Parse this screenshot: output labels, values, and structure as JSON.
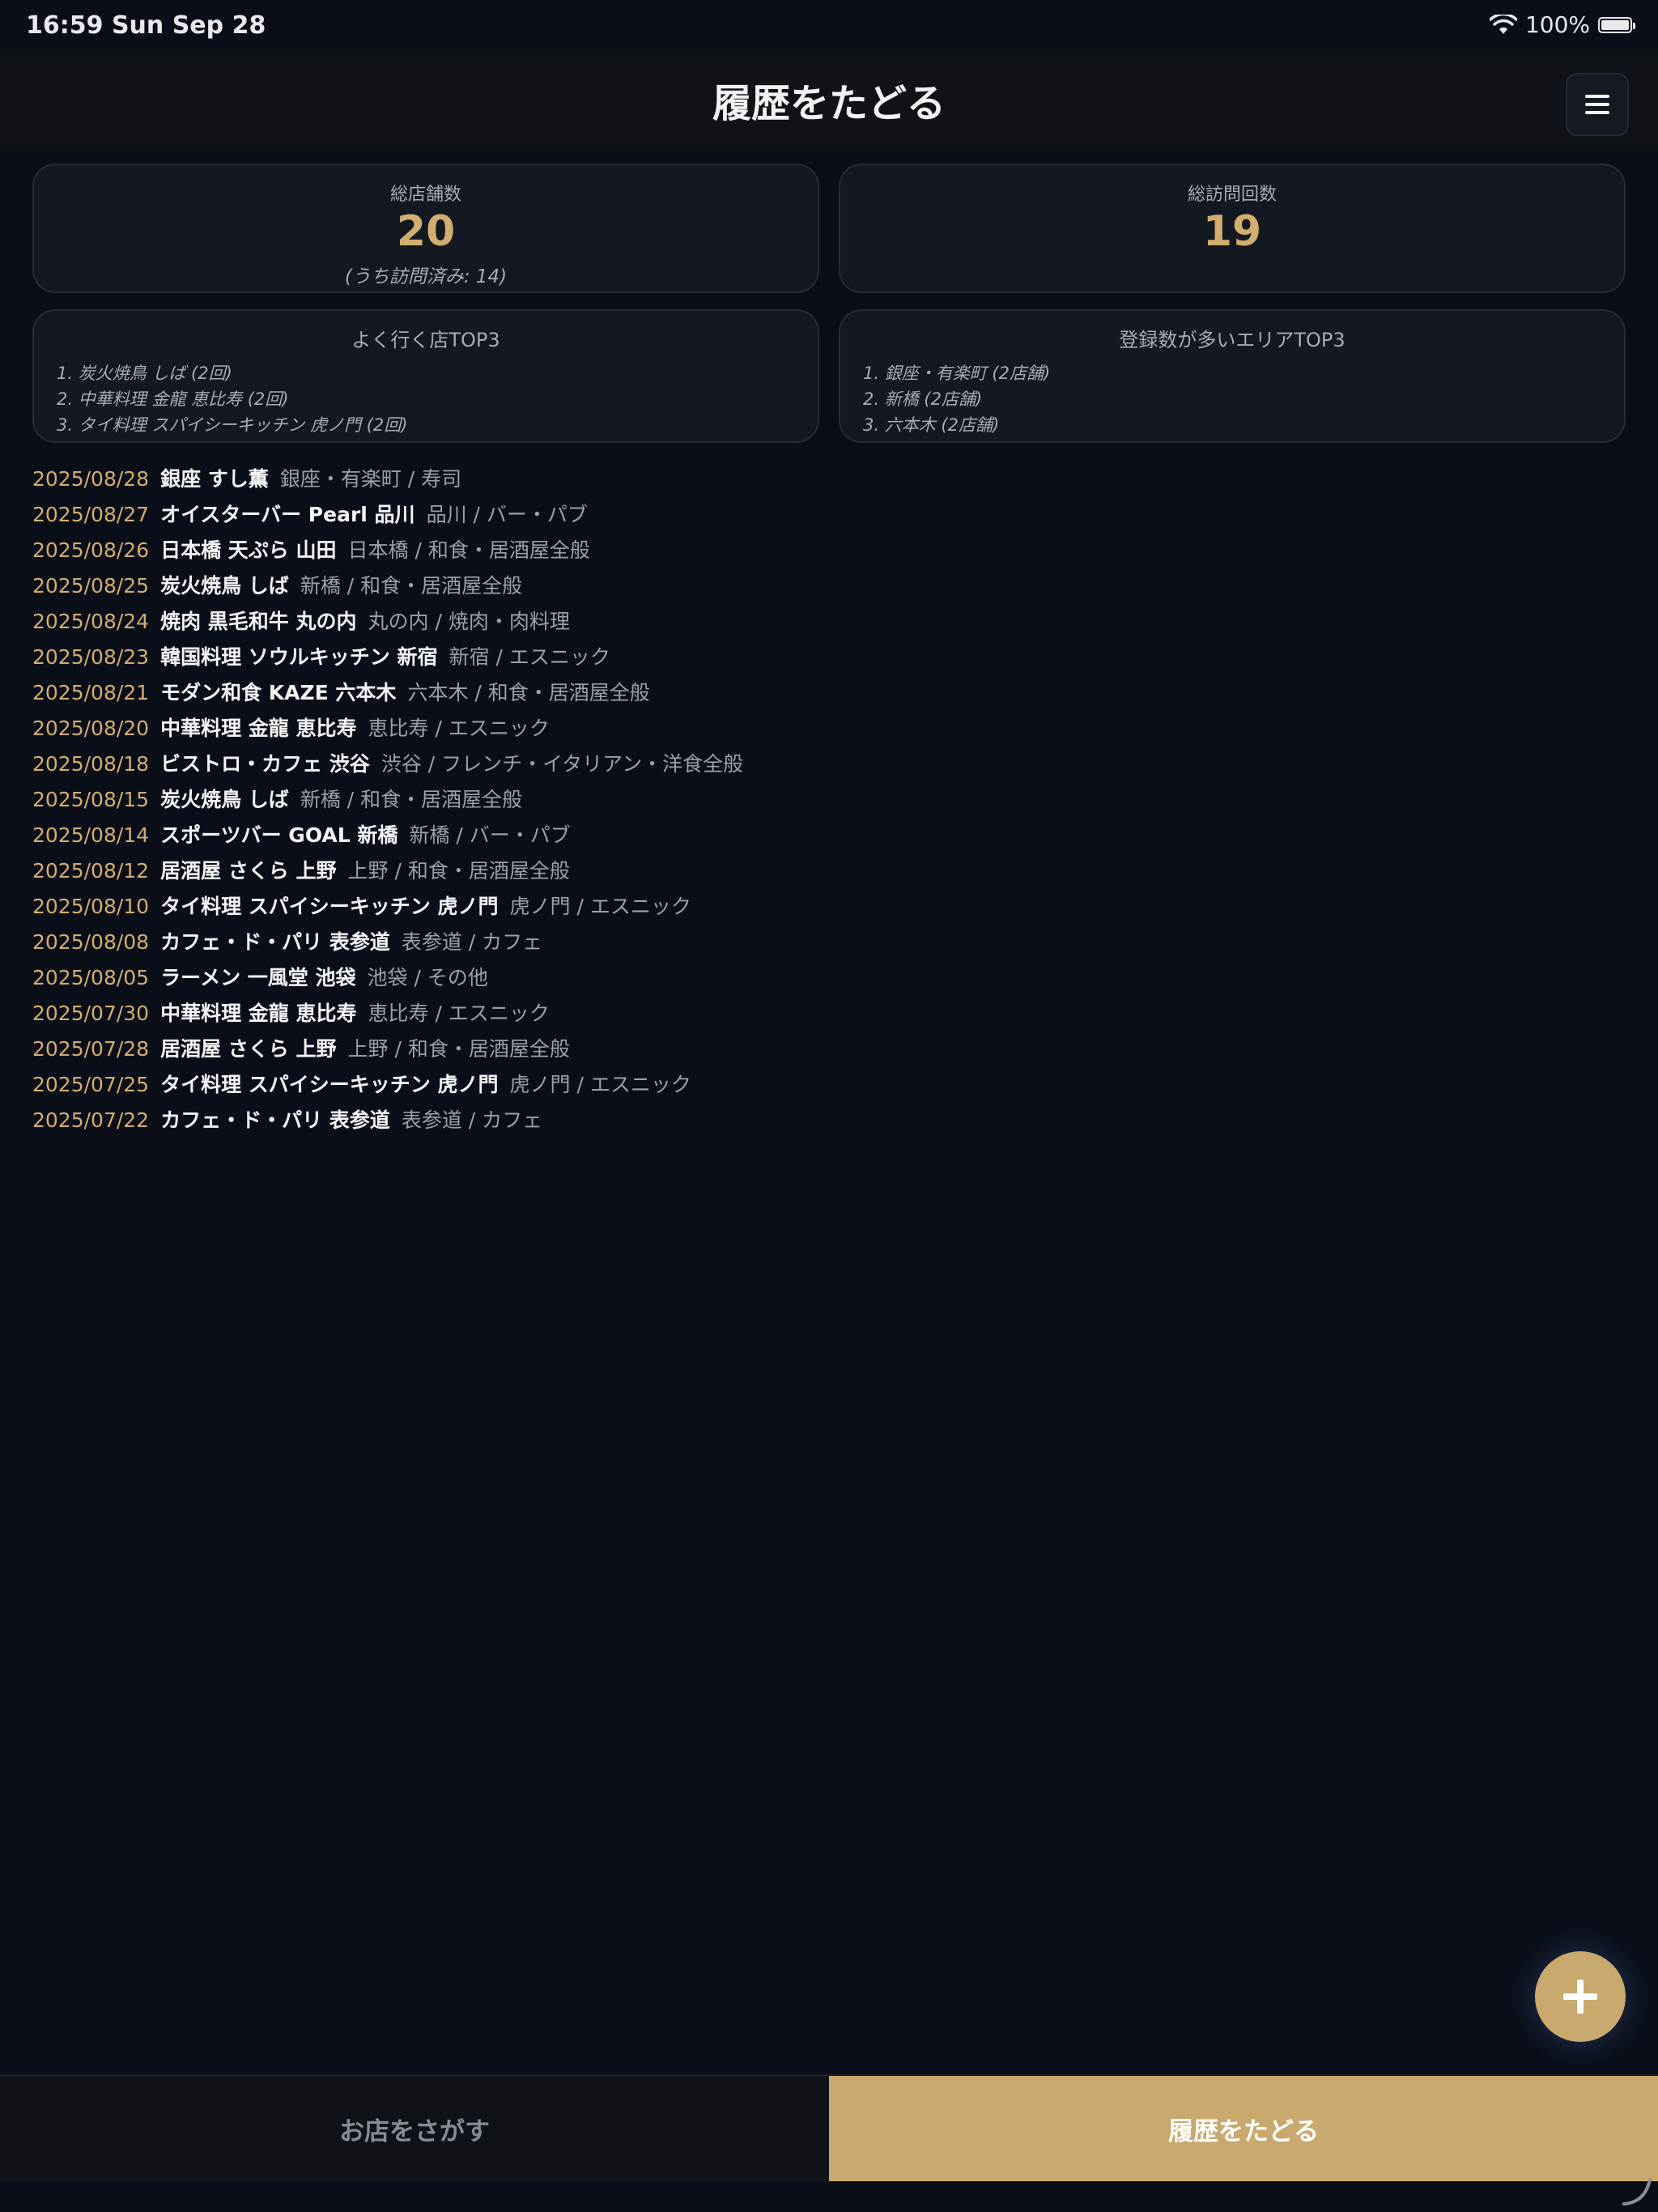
{
  "status": {
    "time": "16:59  Sun Sep 28",
    "battery": "100%"
  },
  "header": {
    "title": "履歴をたどる"
  },
  "stats": {
    "total_stores": {
      "label": "総店舗数",
      "value": "20",
      "sub": "(うち訪問済み: 14)"
    },
    "total_visits": {
      "label": "総訪問回数",
      "value": "19"
    }
  },
  "top_stores": {
    "label": "よく行く店TOP3",
    "items": [
      "1. 炭火焼鳥 しば (2回)",
      "2. 中華料理 金龍 恵比寿 (2回)",
      "3. タイ料理 スパイシーキッチン 虎ノ門 (2回)"
    ]
  },
  "top_areas": {
    "label": "登録数が多いエリアTOP3",
    "items": [
      "1. 銀座・有楽町 (2店舗)",
      "2. 新橋 (2店舗)",
      "3. 六本木 (2店舗)"
    ]
  },
  "history": [
    {
      "date": "2025/08/28",
      "name": "銀座 すし薫",
      "meta": "銀座・有楽町 / 寿司"
    },
    {
      "date": "2025/08/27",
      "name": "オイスターバー Pearl 品川",
      "meta": "品川 / バー・パブ"
    },
    {
      "date": "2025/08/26",
      "name": "日本橋 天ぷら 山田",
      "meta": "日本橋 / 和食・居酒屋全般"
    },
    {
      "date": "2025/08/25",
      "name": "炭火焼鳥 しば",
      "meta": "新橋 / 和食・居酒屋全般"
    },
    {
      "date": "2025/08/24",
      "name": "焼肉 黒毛和牛 丸の内",
      "meta": "丸の内 / 焼肉・肉料理"
    },
    {
      "date": "2025/08/23",
      "name": "韓国料理 ソウルキッチン 新宿",
      "meta": "新宿 / エスニック"
    },
    {
      "date": "2025/08/21",
      "name": "モダン和食 KAZE 六本木",
      "meta": "六本木 / 和食・居酒屋全般"
    },
    {
      "date": "2025/08/20",
      "name": "中華料理 金龍 恵比寿",
      "meta": "恵比寿 / エスニック"
    },
    {
      "date": "2025/08/18",
      "name": "ビストロ・カフェ 渋谷",
      "meta": "渋谷 / フレンチ・イタリアン・洋食全般"
    },
    {
      "date": "2025/08/15",
      "name": "炭火焼鳥 しば",
      "meta": "新橋 / 和食・居酒屋全般"
    },
    {
      "date": "2025/08/14",
      "name": "スポーツバー GOAL 新橋",
      "meta": "新橋 / バー・パブ"
    },
    {
      "date": "2025/08/12",
      "name": "居酒屋 さくら 上野",
      "meta": "上野 / 和食・居酒屋全般"
    },
    {
      "date": "2025/08/10",
      "name": "タイ料理 スパイシーキッチン 虎ノ門",
      "meta": "虎ノ門 / エスニック"
    },
    {
      "date": "2025/08/08",
      "name": "カフェ・ド・パリ 表参道",
      "meta": "表参道 / カフェ"
    },
    {
      "date": "2025/08/05",
      "name": "ラーメン 一風堂 池袋",
      "meta": "池袋 / その他"
    },
    {
      "date": "2025/07/30",
      "name": "中華料理 金龍 恵比寿",
      "meta": "恵比寿 / エスニック"
    },
    {
      "date": "2025/07/28",
      "name": "居酒屋 さくら 上野",
      "meta": "上野 / 和食・居酒屋全般"
    },
    {
      "date": "2025/07/25",
      "name": "タイ料理 スパイシーキッチン 虎ノ門",
      "meta": "虎ノ門 / エスニック"
    },
    {
      "date": "2025/07/22",
      "name": "カフェ・ド・パリ 表参道",
      "meta": "表参道 / カフェ"
    }
  ],
  "fab": {
    "icon": "plus-icon"
  },
  "nav": {
    "search_label": "お店をさがす",
    "history_label": "履歴をたどる"
  },
  "colors": {
    "accent": "#c9a96e",
    "gold_text": "#d3ad6f",
    "background": "#0a0e18"
  }
}
